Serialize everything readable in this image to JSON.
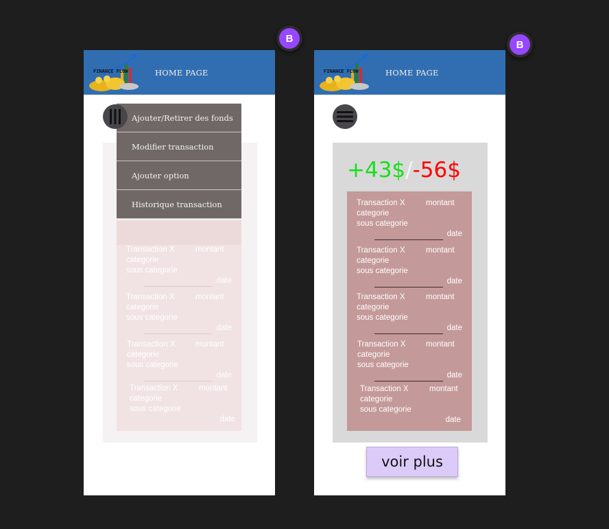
{
  "avatars": [
    {
      "initial": "B"
    },
    {
      "initial": "B"
    }
  ],
  "logo": {
    "text": "FINANCE FLOW"
  },
  "header": {
    "title": "HOME PAGE"
  },
  "menu": {
    "items": [
      {
        "label": "Ajouter/Retirer des fonds"
      },
      {
        "label": "Modifier transaction"
      },
      {
        "label": "Ajouter option"
      },
      {
        "label": "Historique transaction"
      }
    ]
  },
  "balance": {
    "positive": "+43$",
    "separator": "/",
    "negative": "-56$"
  },
  "transactions_left": [
    {
      "name": "Transaction X",
      "amount": "montant",
      "category": "categorie",
      "subcategory": "sous categorie",
      "date": "date"
    },
    {
      "name": "Transaction X",
      "amount": "montant",
      "category": "categorie",
      "subcategory": "sous categorie",
      "date": "date"
    },
    {
      "name": "Transaction X",
      "amount": "montant",
      "category": "categorie",
      "subcategory": "sous categorie",
      "date": "date"
    },
    {
      "name": "Transaction X",
      "amount": "montant",
      "category": "categorie",
      "subcategory": "sous categorie",
      "date": "date"
    }
  ],
  "transactions_right": [
    {
      "name": "Transaction X",
      "amount": "montant",
      "category": "categorie",
      "subcategory": "sous categorie",
      "date": "date"
    },
    {
      "name": "Transaction X",
      "amount": "montant",
      "category": "categorie",
      "subcategory": "sous categorie",
      "date": "date"
    },
    {
      "name": "Transaction X",
      "amount": "montant",
      "category": "categorie",
      "subcategory": "sous categorie",
      "date": "date"
    },
    {
      "name": "Transaction X",
      "amount": "montant",
      "category": "categorie",
      "subcategory": "sous categorie",
      "date": "date"
    },
    {
      "name": "Transaction X",
      "amount": "montant",
      "category": "categorie",
      "subcategory": "sous categorie",
      "date": "date"
    }
  ],
  "buttons": {
    "more": "voir plus"
  },
  "colors": {
    "header": "#316eb1",
    "positive": "#16e01a",
    "negative": "#ff0000",
    "list_bg": "#c49999",
    "accent": "#9747ff"
  }
}
